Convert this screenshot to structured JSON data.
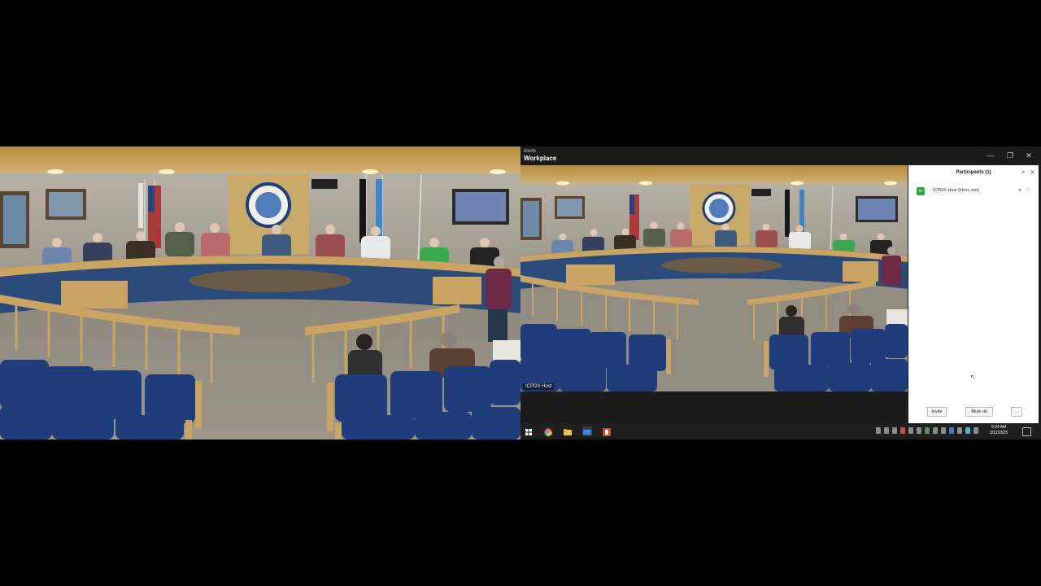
{
  "zoom_window": {
    "brand_small": "zoom",
    "brand_big": "Workplace",
    "window_controls": [
      "minimize-icon",
      "restore-icon",
      "close-icon"
    ],
    "video_label": "ICPDS Host",
    "participants_panel": {
      "title": "Participants (1)",
      "header_icons": [
        "popout-icon",
        "close-icon"
      ],
      "participants": [
        {
          "initials": "IH",
          "name": "ICPDS Host (Host, me)",
          "icons": [
            "microphone-icon",
            "camera-icon"
          ]
        }
      ],
      "buttons": {
        "invite": "Invite",
        "mute_all": "Mute all",
        "more": "..."
      }
    }
  },
  "taskbar": {
    "items": [
      "windows-start-icon",
      "chrome-icon",
      "file-explorer-icon",
      "zoom-app-icon",
      "powerpoint-icon"
    ],
    "clock_time": "9:24 AM",
    "clock_date": "3/12/2025"
  },
  "colors": {
    "room_wall": "#a8a196",
    "ceiling_wood": "#c09a4f",
    "dais_wood": "#c9a462",
    "dais_blue": "#2a4a7a",
    "seat_blue": "#1f3d7a",
    "zoom_dark": "#1b1b1b",
    "avatar_green": "#28a745"
  }
}
